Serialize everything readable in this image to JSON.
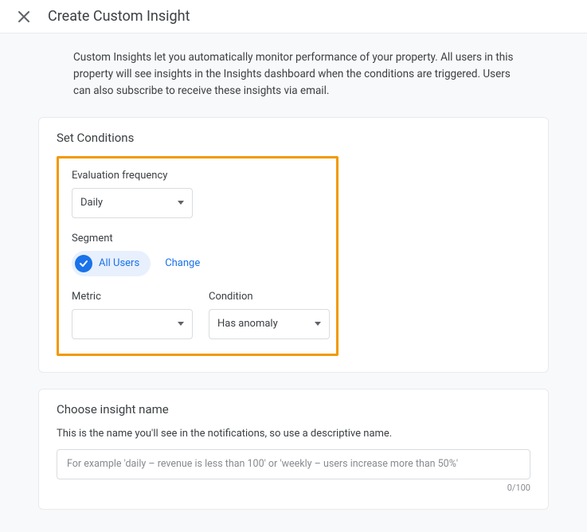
{
  "header": {
    "title": "Create Custom Insight"
  },
  "intro": "Custom Insights let you automatically monitor performance of your property. All users in this property will see insights in the Insights dashboard when the conditions are triggered. Users can also subscribe to receive these insights via email.",
  "conditions": {
    "title": "Set Conditions",
    "evalLabel": "Evaluation frequency",
    "evalValue": "Daily",
    "segmentLabel": "Segment",
    "segmentChip": "All Users",
    "changeLink": "Change",
    "metricLabel": "Metric",
    "metricValue": "",
    "conditionLabel": "Condition",
    "conditionValue": "Has anomaly"
  },
  "name": {
    "title": "Choose insight name",
    "intro": "This is the name you'll see in the notifications, so use a descriptive name.",
    "placeholder": "For example 'daily – revenue is less than 100' or 'weekly – users increase more than 50%'",
    "value": "",
    "counter": "0/100"
  }
}
